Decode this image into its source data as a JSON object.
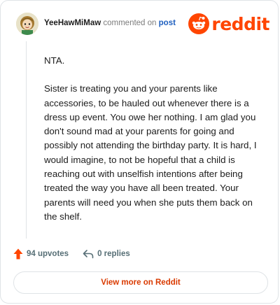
{
  "comment": {
    "username": "YeeHawMiMaw",
    "verb": "commented on",
    "link_label": "post",
    "paragraphs": [
      "NTA.",
      "Sister is treating you and your parents like accessories, to be hauled out whenever there is a dress up event. You owe her nothing. I am glad you don't sound mad at your parents for going and possibly not attending the birthday party. It is hard, I would imagine, to not be hopeful that a child is reaching out with unselfish intentions after being treated the way you have all been treated. Your parents will need you when she puts them back on the shelf."
    ]
  },
  "brand": {
    "wordmark": "reddit",
    "color": "#ff4500"
  },
  "actions": {
    "upvotes_label": "94 upvotes",
    "replies_label": "0 replies"
  },
  "footer": {
    "view_more_label": "View more on Reddit"
  },
  "icons": {
    "avatar": "user-avatar-cartoon",
    "logo": "reddit-snoo-icon",
    "upvote": "upvote-arrow-icon",
    "reply": "reply-arrow-icon"
  }
}
